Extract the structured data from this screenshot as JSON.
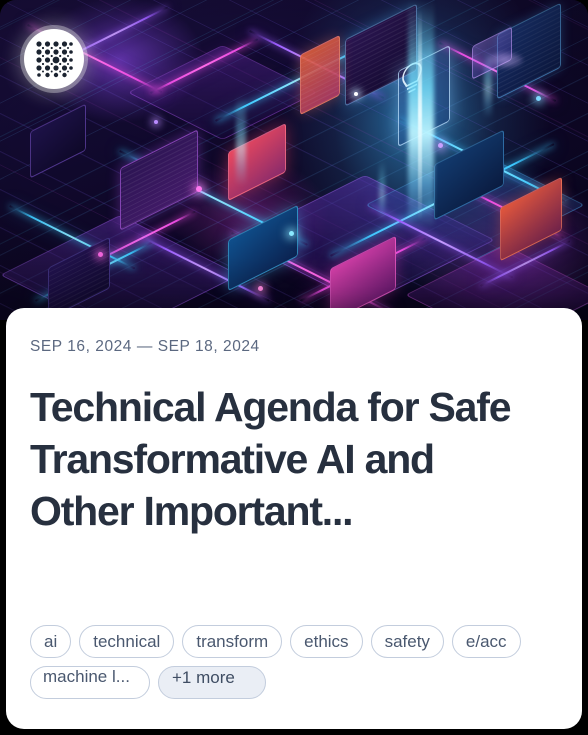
{
  "card": {
    "dates": "SEP 16, 2024 — SEP 18, 2024",
    "title": "Technical Agenda for Safe Transformative AI and Other Important...",
    "logo_icon": "dotted-grid-logo-icon"
  },
  "tags": [
    {
      "label": "ai",
      "name": "tag-ai",
      "style": "normal"
    },
    {
      "label": "technical",
      "name": "tag-technical",
      "style": "normal"
    },
    {
      "label": "transform",
      "name": "tag-transform",
      "style": "normal"
    },
    {
      "label": "ethics",
      "name": "tag-ethics",
      "style": "normal"
    },
    {
      "label": "safety",
      "name": "tag-safety",
      "style": "normal"
    },
    {
      "label": "e/acc",
      "name": "tag-e-acc",
      "style": "normal"
    },
    {
      "label": "machine l...",
      "name": "tag-machine-learning",
      "style": "overflowing"
    },
    {
      "label": "+1 more",
      "name": "tag-more-badge",
      "style": "more-badge"
    }
  ],
  "colors": {
    "page_background": "#000000",
    "card_background": "#ffffff",
    "title_text": "#27303f",
    "date_text": "#5b6880",
    "tag_border": "#c3cddd",
    "tag_text": "#4a586f",
    "more_badge_fill": "#eaeef5",
    "hero_neon_magenta": "#e84ae0",
    "hero_neon_cyan": "#3cc8ff",
    "hero_neon_purple": "#9b5cff",
    "hero_background": "#0d0725"
  }
}
